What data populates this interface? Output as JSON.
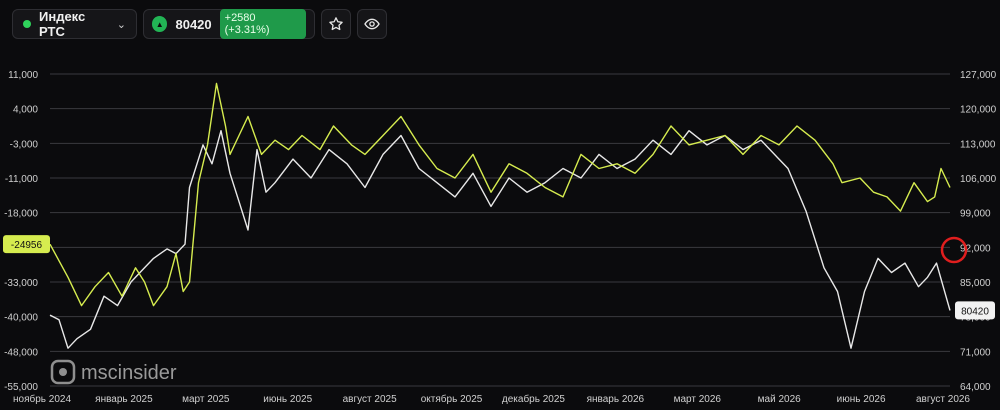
{
  "header": {
    "ticker_name": "Индекс РТС",
    "price": "80420",
    "change": "+2580 (+3.31%)",
    "colors": {
      "live_dot": "#2fd35b",
      "up": "#22b455",
      "badge": "#1f9a4a"
    },
    "icons": [
      "chevron-down-icon",
      "triangle-up-icon",
      "star-icon",
      "eye-icon"
    ]
  },
  "watermark": "mscinsider",
  "chart_data": {
    "type": "line",
    "x_ticks": [
      "ноябрь 2024",
      "январь 2025",
      "март 2025",
      "июнь 2025",
      "август 2025",
      "октябрь 2025",
      "декабрь 2025",
      "январь 2026",
      "март 2026",
      "май 2026",
      "июнь 2026",
      "август 2026"
    ],
    "y_left": {
      "ticks": [
        "11,000",
        "4,000",
        "-3,000",
        "-11,000",
        "-18,000",
        "-25,000",
        "-33,000",
        "-40,000",
        "-48,000",
        "-55,000"
      ],
      "range": [
        -55000,
        11000
      ]
    },
    "y_right": {
      "ticks": [
        "127,000",
        "120,000",
        "113,000",
        "106,000",
        "99,000",
        "92,000",
        "85,000",
        "78,000",
        "71,000",
        "64,000"
      ],
      "range": [
        64000,
        127000
      ]
    },
    "left_label": "-24956",
    "right_label": "80420",
    "highlight": "red-circle",
    "grid": true,
    "series": [
      {
        "color": "#d6ec4f",
        "axis": "left",
        "x": [
          0.0,
          0.02,
          0.035,
          0.05,
          0.065,
          0.08,
          0.095,
          0.105,
          0.115,
          0.13,
          0.14,
          0.148,
          0.155,
          0.165,
          0.175,
          0.185,
          0.195,
          0.2,
          0.21,
          0.22,
          0.235,
          0.25,
          0.265,
          0.28,
          0.3,
          0.315,
          0.335,
          0.35,
          0.37,
          0.39,
          0.41,
          0.43,
          0.45,
          0.47,
          0.49,
          0.51,
          0.53,
          0.55,
          0.57,
          0.59,
          0.61,
          0.63,
          0.65,
          0.67,
          0.69,
          0.71,
          0.73,
          0.75,
          0.77,
          0.79,
          0.81,
          0.83,
          0.85,
          0.87,
          0.88,
          0.9,
          0.915,
          0.93,
          0.945,
          0.96,
          0.975,
          0.983,
          0.99,
          1.0
        ],
        "y": [
          -25000,
          -32000,
          -38000,
          -34000,
          -31000,
          -36000,
          -30000,
          -33000,
          -38000,
          -34000,
          -27000,
          -35000,
          -33000,
          -12000,
          -4000,
          9000,
          0,
          -6000,
          -2000,
          2000,
          -6000,
          -3000,
          -5000,
          -2000,
          -5000,
          0,
          -4000,
          -6000,
          -2000,
          2000,
          -4000,
          -9000,
          -11000,
          -6000,
          -14000,
          -8000,
          -10000,
          -13000,
          -15000,
          -6000,
          -9000,
          -8000,
          -10000,
          -6000,
          0,
          -4000,
          -3000,
          -2000,
          -6000,
          -2000,
          -4000,
          0,
          -3000,
          -8000,
          -12000,
          -11000,
          -14000,
          -15000,
          -18000,
          -12000,
          -16000,
          -15000,
          -9000,
          -13000
        ]
      },
      {
        "color": "#e8e8e8",
        "axis": "left",
        "x": [
          0.0,
          0.01,
          0.02,
          0.03,
          0.045,
          0.06,
          0.075,
          0.09,
          0.1,
          0.115,
          0.13,
          0.14,
          0.15,
          0.155,
          0.17,
          0.18,
          0.19,
          0.2,
          0.21,
          0.22,
          0.23,
          0.24,
          0.25,
          0.27,
          0.29,
          0.31,
          0.33,
          0.35,
          0.37,
          0.39,
          0.41,
          0.43,
          0.45,
          0.47,
          0.49,
          0.51,
          0.53,
          0.55,
          0.57,
          0.59,
          0.61,
          0.63,
          0.65,
          0.67,
          0.69,
          0.71,
          0.73,
          0.75,
          0.77,
          0.79,
          0.81,
          0.82,
          0.84,
          0.86,
          0.875,
          0.89,
          0.905,
          0.92,
          0.935,
          0.95,
          0.965,
          0.975,
          0.985,
          1.0
        ],
        "y": [
          -40000,
          -41000,
          -47000,
          -45000,
          -43000,
          -36000,
          -38000,
          -33000,
          -31000,
          -28000,
          -26000,
          -27000,
          -25000,
          -13000,
          -4000,
          -8000,
          -1000,
          -10000,
          -16000,
          -22000,
          -5000,
          -14000,
          -12000,
          -7000,
          -11000,
          -5000,
          -8000,
          -13000,
          -6000,
          -2000,
          -9000,
          -12000,
          -15000,
          -10000,
          -17000,
          -11000,
          -14000,
          -12000,
          -9000,
          -11000,
          -6000,
          -9000,
          -7000,
          -3000,
          -6000,
          -1000,
          -4000,
          -2000,
          -5000,
          -3000,
          -7000,
          -9000,
          -18000,
          -30000,
          -35000,
          -47000,
          -35000,
          -28000,
          -31000,
          -29000,
          -34000,
          -32000,
          -29000,
          -39000
        ]
      }
    ]
  }
}
